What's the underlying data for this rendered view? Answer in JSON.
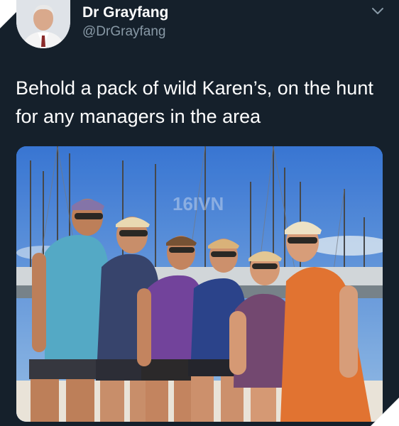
{
  "author": {
    "display_name": "Dr Grayfang",
    "handle": "@DrGrayfang"
  },
  "tweet": {
    "text": "Behold a pack of wild Karen’s, on the hunt for any managers in the area"
  },
  "photo": {
    "watermark": "16IVN",
    "people_count": 6
  },
  "icons": {
    "menu": "chevron-down-icon"
  },
  "colors": {
    "background": "#15202b",
    "secondary_text": "#8899a6",
    "sky": "#2f78d8"
  }
}
